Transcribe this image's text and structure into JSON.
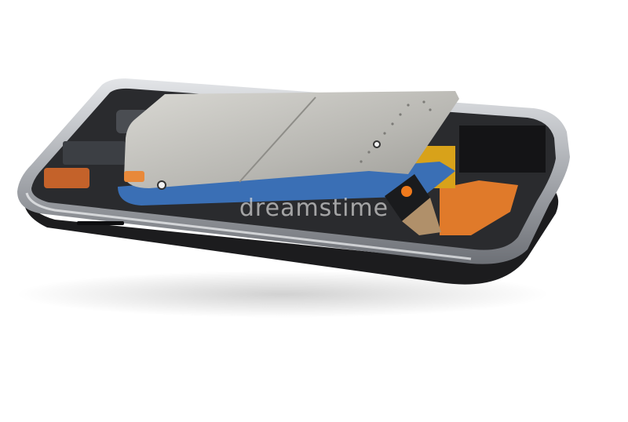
{
  "photo": {
    "subject": "disassembled-smartphone",
    "background_color": "#ffffff",
    "colors": {
      "body_black": "#1c1c1e",
      "frame_silver": "#b9bcc0",
      "board_blue": "#3a6fb5",
      "shield_gray": "#c9c9c5",
      "flex_orange": "#e07a2a"
    }
  },
  "watermark": {
    "text": "dreamstime"
  }
}
